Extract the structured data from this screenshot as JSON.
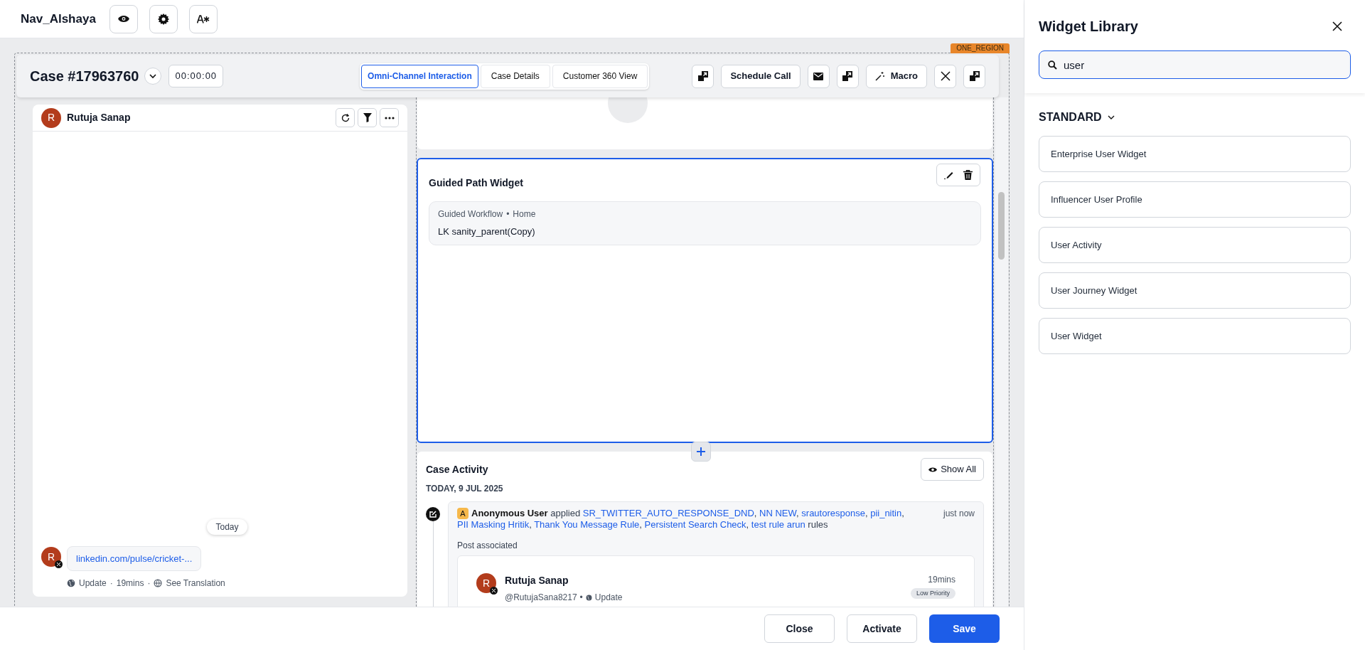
{
  "header": {
    "title": "Nav_Alshaya"
  },
  "region_tag": "ONE_REGION",
  "case": {
    "title": "Case #17963760",
    "timer": "00:00:00"
  },
  "tabs": [
    {
      "label": "Omni-Channel Interaction",
      "selected": true
    },
    {
      "label": "Case Details",
      "selected": false
    },
    {
      "label": "Customer 360 View",
      "selected": false
    }
  ],
  "toolbar": [
    {
      "kind": "icon"
    },
    {
      "kind": "text",
      "label": "Schedule Call"
    },
    {
      "kind": "icon"
    },
    {
      "kind": "icon"
    },
    {
      "kind": "text",
      "label": "Macro"
    },
    {
      "kind": "icon"
    },
    {
      "kind": "icon"
    }
  ],
  "conversation": {
    "avatar": "R",
    "name": "Rutuja Sanap",
    "date_divider": "Today",
    "message": {
      "avatar": "R",
      "link": "linkedin.com/pulse/cricket-...",
      "type": "Update",
      "separator": "·",
      "time": "19mins",
      "translate": "See Translation"
    }
  },
  "guided_path": {
    "title": "Guided Path Widget",
    "selected": true,
    "breadcrumb": [
      "Guided Workflow",
      "Home"
    ],
    "breadcrumb_separator": "•",
    "workflow": "LK sanity_parent(Copy)"
  },
  "case_activity": {
    "title": "Case Activity",
    "show_all": "Show All",
    "date": "TODAY, 9 JUL 2025",
    "entry": {
      "badge": "A",
      "actor": "Anonymous User",
      "verb": "applied",
      "rules": [
        "SR_TWITTER_AUTO_RESPONSE_DND",
        "NN NEW",
        "srautoresponse",
        "pii_nitin",
        "PII Masking Hritik",
        "Thank You Message Rule",
        "Persistent Search Check",
        "test rule arun"
      ],
      "rule_separator": ",",
      "suffix": "rules",
      "time": "just now",
      "post_label": "Post associated",
      "post": {
        "avatar": "R",
        "name": "Rutuja Sanap",
        "handle": "@RutujaSana8217",
        "separator": "•",
        "type": "Update",
        "time": "19mins",
        "priority": "Low Priority"
      }
    }
  },
  "footer": [
    {
      "label": "Close",
      "kind": "secondary"
    },
    {
      "label": "Activate",
      "kind": "secondary"
    },
    {
      "label": "Save",
      "kind": "primary"
    }
  ],
  "widget_library": {
    "title": "Widget Library",
    "search": "user",
    "section": "STANDARD",
    "items": [
      "Enterprise User Widget",
      "Influencer User Profile",
      "User Activity",
      "User Journey Widget",
      "User Widget"
    ]
  }
}
